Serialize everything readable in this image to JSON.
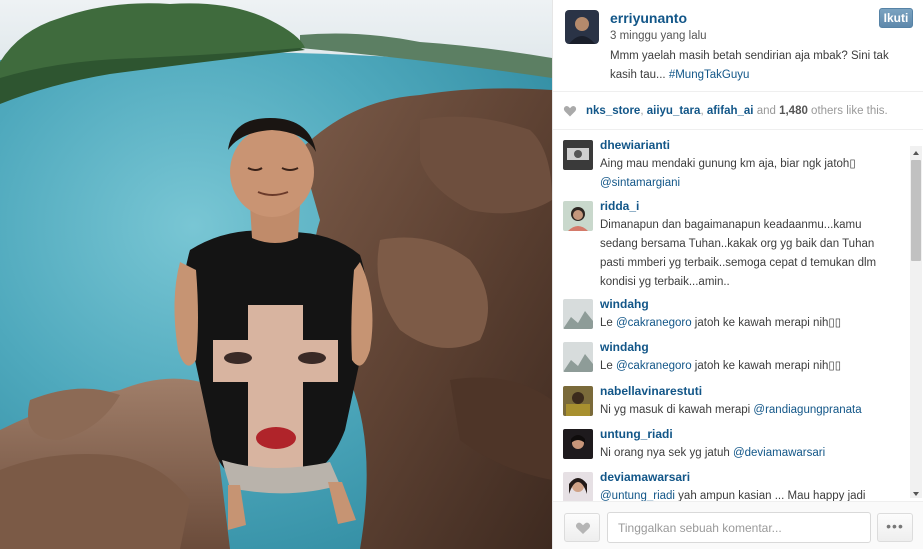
{
  "post": {
    "username": "erriyunanto",
    "time": "3 minggu yang lalu",
    "follow_label": "Ikuti",
    "caption_text": "Mmm yaelah masih betah sendirian aja mbak? Sini tak kasih tau...",
    "caption_tag": "#MungTakGuyu"
  },
  "likes": {
    "users": [
      "nks_store",
      "aiiyu_tara",
      "afifah_ai"
    ],
    "sep1": ", ",
    "sep2": ", ",
    "and": " and ",
    "count": "1,480",
    "suffix": " others like this."
  },
  "comments": [
    {
      "user": "dhewiarianti",
      "text": "Aing mau mendaki gunung km aja, biar ngk jatoh▯",
      "mention": "@sintamargiani",
      "after": ""
    },
    {
      "user": "ridda_i",
      "text": "Dimanapun dan bagaimanapun keadaanmu...kamu sedang bersama Tuhan..kakak org yg baik dan Tuhan pasti mmberi yg terbaik..semoga cepat d temukan dlm kondisi yg terbaik...amin..",
      "mention": "",
      "after": ""
    },
    {
      "user": "windahg",
      "text": "Le ",
      "mention": "@cakranegoro",
      "after": " jatoh ke kawah merapi nih▯▯"
    },
    {
      "user": "windahg",
      "text": "Le ",
      "mention": "@cakranegoro",
      "after": " jatoh ke kawah merapi nih▯▯"
    },
    {
      "user": "nabellavinarestuti",
      "text": "Ni yg masuk di kawah merapi ",
      "mention": "@randiagungpranata",
      "after": ""
    },
    {
      "user": "untung_riadi",
      "text": "Ni orang nya sek yg jatuh ",
      "mention": "@deviamawarsari",
      "after": ""
    },
    {
      "user": "deviamawarsari",
      "text": "",
      "mention": "@untung_riadi",
      "after": " yah ampun kasian ... Mau happy jadi"
    }
  ],
  "footer": {
    "comment_placeholder": "Tinggalkan sebuah komentar...",
    "more_label": "•••"
  },
  "icons": {
    "heart": "heart-icon",
    "more": "more-options-icon"
  },
  "colors": {
    "link": "#125688",
    "follow_button": "#6f97b6",
    "text": "#3d3d3d"
  }
}
